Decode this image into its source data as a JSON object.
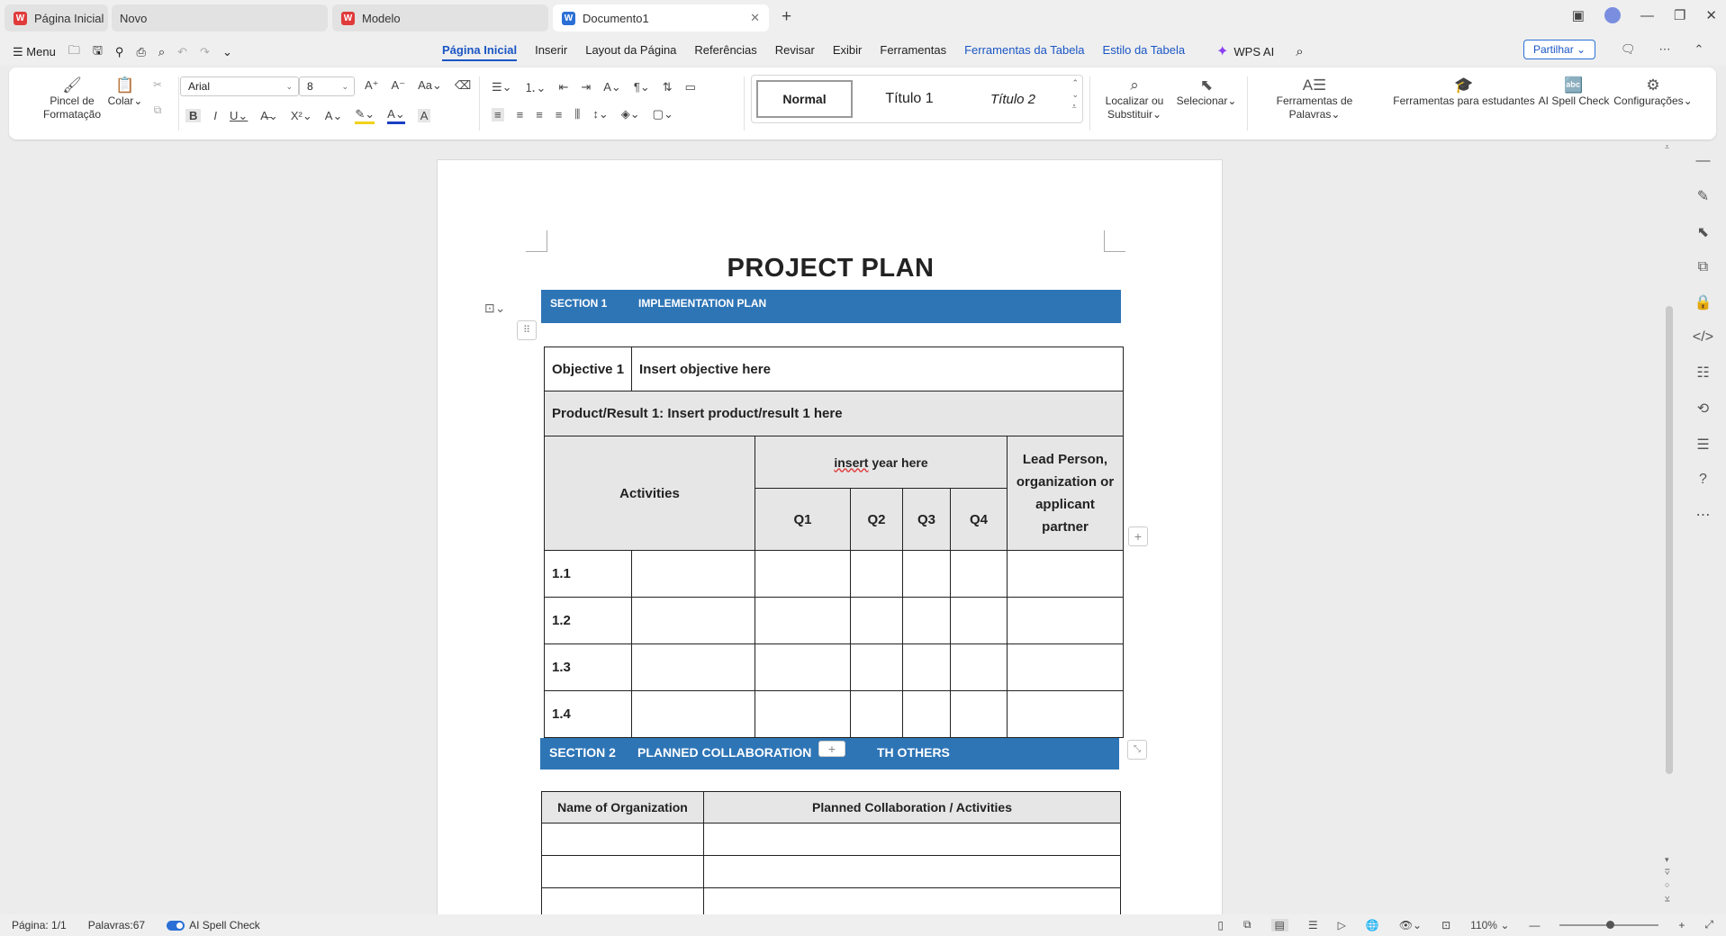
{
  "tabs": [
    {
      "label": "Página Inicial",
      "icon": "wps-logo-icon"
    },
    {
      "label": "Novo"
    },
    {
      "label": "Modelo",
      "icon": "wps-logo-icon"
    },
    {
      "label": "Documento1",
      "icon": "writer-logo-icon"
    }
  ],
  "menu": {
    "menu_label": "Menu",
    "items": [
      "Página Inicial",
      "Inserir",
      "Layout da Página",
      "Referências",
      "Revisar",
      "Exibir",
      "Ferramentas",
      "Ferramentas da Tabela",
      "Estilo da Tabela"
    ],
    "wps_ai": "WPS AI",
    "share": "Partilhar"
  },
  "ribbon": {
    "format_painter": "Pincel de Formatação",
    "paste": "Colar",
    "font_name": "Arial",
    "font_size": "8",
    "styles": [
      "Normal",
      "Título 1",
      "Título 2"
    ],
    "find_replace": "Localizar ou Substituir",
    "select": "Selecionar",
    "word_tools": "Ferramentas de Palavras",
    "student_tools": "Ferramentas para estudantes",
    "ai_spell": "AI Spell Check",
    "settings": "Configurações"
  },
  "document": {
    "title": "PROJECT PLAN",
    "section1": {
      "num": "SECTION 1",
      "name": "IMPLEMENTATION PLAN"
    },
    "objective_label": "Objective 1",
    "objective_value": "Insert objective here",
    "product_result": "Product/Result 1: Insert product/result 1 here",
    "activities_header": "Activities",
    "year_header_a": "insert",
    "year_header_b": " year here",
    "quarters": [
      "Q1",
      "Q2",
      "Q3",
      "Q4"
    ],
    "lead_header": "Lead Person, organization or applicant partner",
    "rows": [
      "1.1",
      "1.2",
      "1.3",
      "1.4"
    ],
    "section2": {
      "num": "SECTION 2",
      "name_a": "PLANNED COLLABORATION",
      "name_b": "TH OTHERS"
    },
    "collab_headers": [
      "Name of Organization",
      "Planned Collaboration / Activities"
    ]
  },
  "status": {
    "page": "Página: 1/1",
    "words": "Palavras:67",
    "spell": "AI Spell Check",
    "zoom": "110%"
  }
}
